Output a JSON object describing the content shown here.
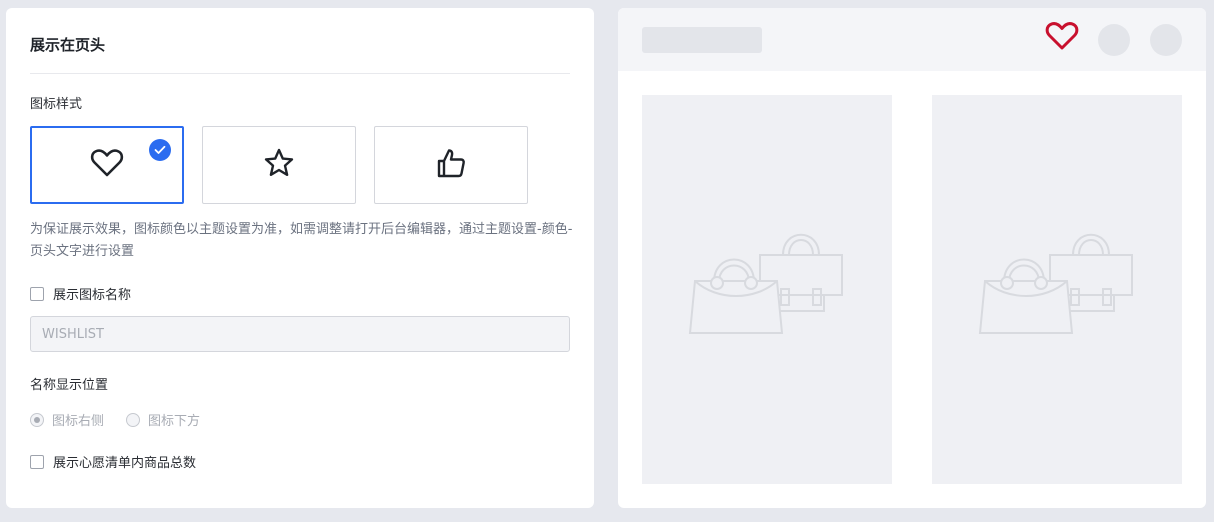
{
  "settings": {
    "section_title": "展示在页头",
    "icon_style_label": "图标样式",
    "icon_options": [
      {
        "icon": "heart-icon",
        "selected": true
      },
      {
        "icon": "star-icon",
        "selected": false
      },
      {
        "icon": "thumbs-up-icon",
        "selected": false
      }
    ],
    "help_text": "为保证展示效果，图标颜色以主题设置为准，如需调整请打开后台编辑器，通过主题设置-颜色-页头文字进行设置",
    "show_icon_name_label": "展示图标名称",
    "show_icon_name_checked": false,
    "icon_name_value": "WISHLIST",
    "name_position_label": "名称显示位置",
    "position_options": [
      {
        "label": "图标右侧",
        "checked": true
      },
      {
        "label": "图标下方",
        "checked": false
      }
    ],
    "show_count_label": "展示心愿清单内商品总数",
    "show_count_checked": false
  },
  "preview": {
    "header_icon": "heart-icon",
    "header_icon_color": "#c8102e",
    "product_image_icon": "shopping-bags-icon"
  },
  "colors": {
    "accent": "#2b6cf0"
  }
}
